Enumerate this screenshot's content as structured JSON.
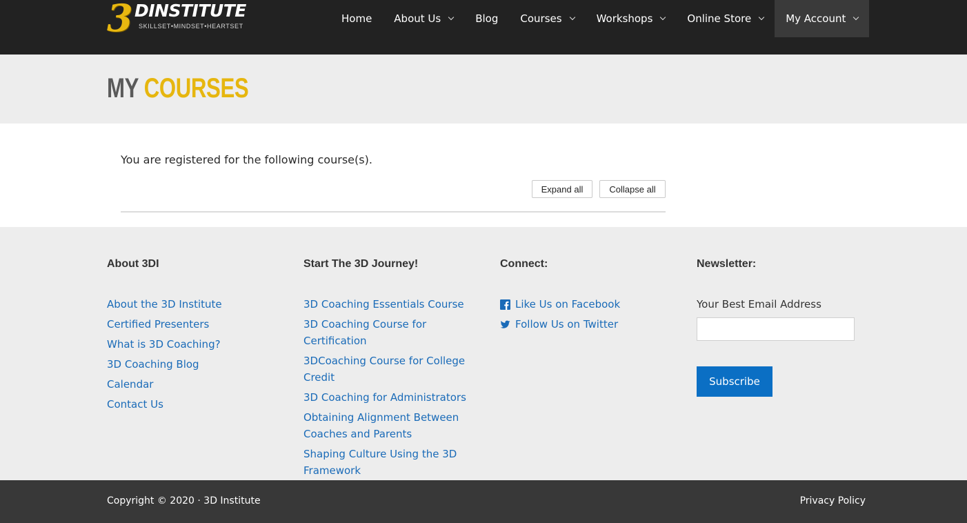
{
  "logo": {
    "mark": "3",
    "word": "DINSTITUTE",
    "tagline": "SKILLSET•MINDSET•HEARTSET"
  },
  "nav": [
    {
      "label": "Home",
      "dropdown": false
    },
    {
      "label": "About Us",
      "dropdown": true
    },
    {
      "label": "Blog",
      "dropdown": false
    },
    {
      "label": "Courses",
      "dropdown": true
    },
    {
      "label": "Workshops",
      "dropdown": true
    },
    {
      "label": "Online Store",
      "dropdown": true
    },
    {
      "label": "My Account",
      "dropdown": true,
      "active": true
    }
  ],
  "page": {
    "title_part1": "MY ",
    "title_part2": "COURSES"
  },
  "content": {
    "intro": "You are registered for the following course(s).",
    "expand_label": "Expand all",
    "collapse_label": "Collapse all"
  },
  "footer": {
    "about": {
      "heading": "About 3DI",
      "links": [
        "About the 3D Institute",
        "Certified Presenters",
        "What is 3D Coaching?",
        "3D Coaching Blog",
        "Calendar",
        "Contact Us"
      ]
    },
    "journey": {
      "heading": "Start The 3D Journey!",
      "links": [
        "3D Coaching Essentials Course",
        "3D Coaching Course for Certification",
        "3DCoaching Course for College Credit",
        "3D Coaching for Administrators",
        "Obtaining Alignment Between Coaches and Parents",
        "Shaping Culture Using the 3D Framework"
      ]
    },
    "connect": {
      "heading": "Connect:",
      "links": [
        {
          "icon": "facebook-icon",
          "label": "Like Us on Facebook"
        },
        {
          "icon": "twitter-icon",
          "label": "Follow Us on Twitter"
        }
      ]
    },
    "newsletter": {
      "heading": "Newsletter:",
      "email_label": "Your Best Email Address",
      "email_value": "",
      "subscribe_label": "Subscribe"
    }
  },
  "bottom": {
    "copyright": "Copyright © 2020 · 3D Institute",
    "privacy": "Privacy Policy"
  },
  "colors": {
    "header_bg": "#222222",
    "accent_gold": "#e6b60f",
    "link_blue": "#1a6bb8",
    "button_blue": "#0b6fc4",
    "footer_bar": "#383838"
  }
}
